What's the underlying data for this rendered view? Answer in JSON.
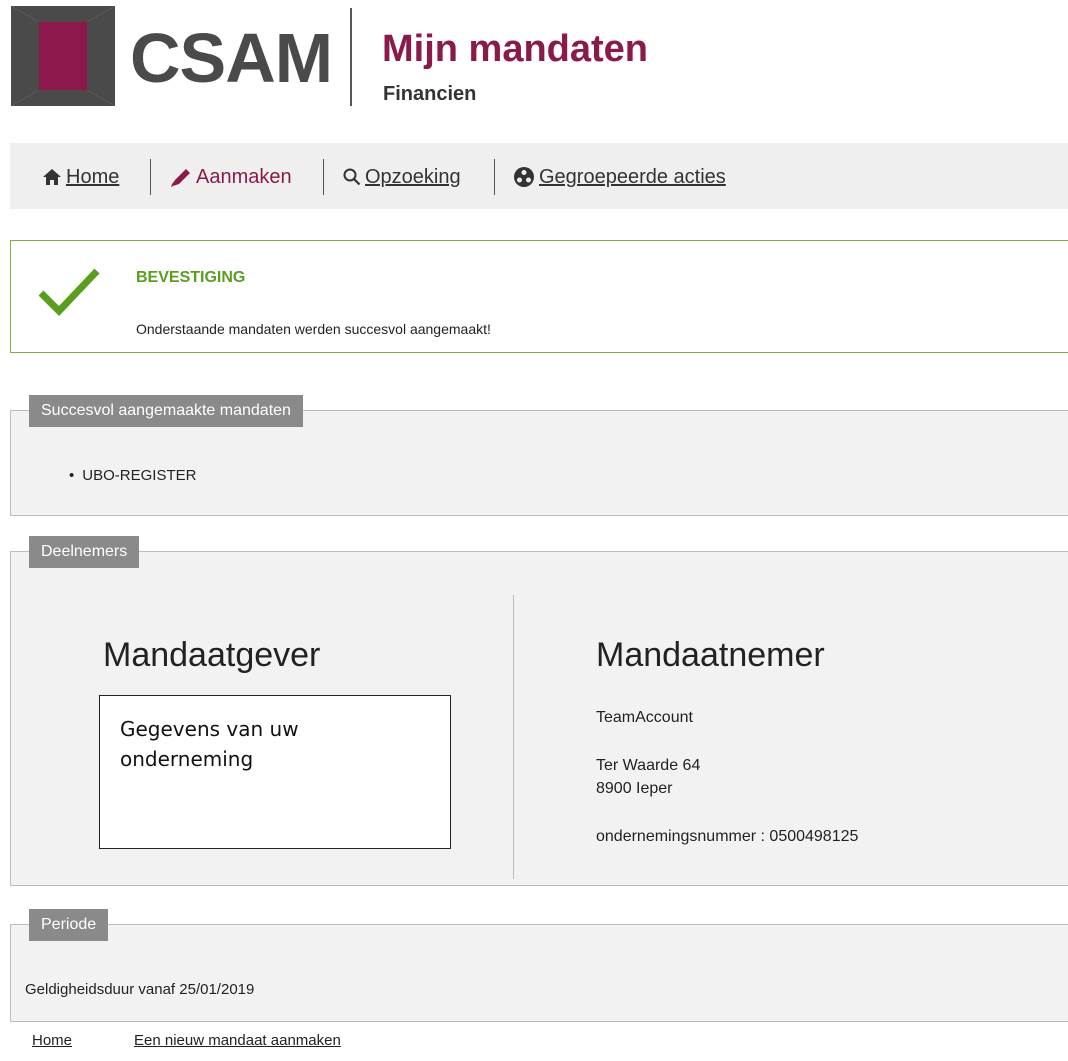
{
  "header": {
    "logo_text": "CSAM",
    "app_title": "Mijn mandaten",
    "app_subtitle": "Financien"
  },
  "nav": {
    "items": [
      {
        "label": "Home",
        "icon": "home-icon"
      },
      {
        "label": "Aanmaken",
        "icon": "pencil-icon"
      },
      {
        "label": "Opzoeking",
        "icon": "search-icon"
      },
      {
        "label": "Gegroepeerde acties",
        "icon": "group-icon"
      }
    ]
  },
  "confirmation": {
    "title": "BEVESTIGING",
    "message": "Onderstaande mandaten werden succesvol aangemaakt!"
  },
  "created": {
    "legend": "Succesvol aangemaakte mandaten",
    "items": [
      "UBO-REGISTER"
    ]
  },
  "participants": {
    "legend": "Deelnemers",
    "mandator": {
      "title": "Mandaatgever",
      "note": "Gegevens van uw onderneming"
    },
    "mandatee": {
      "title": "Mandaatnemer",
      "name": "TeamAccount",
      "address_line1": "Ter Waarde 64",
      "address_line2": "8900 Ieper",
      "company_number": "ondernemingsnummer : 0500498125"
    }
  },
  "period": {
    "legend": "Periode",
    "text": "Geldigheidsduur vanaf 25/01/2019"
  },
  "footer": {
    "links": [
      "Home",
      "Een nieuw mandaat aanmaken"
    ]
  },
  "colors": {
    "brand": "#8b1a4a",
    "success": "#5a9e1e",
    "legend_bg": "#8a8a8a"
  }
}
